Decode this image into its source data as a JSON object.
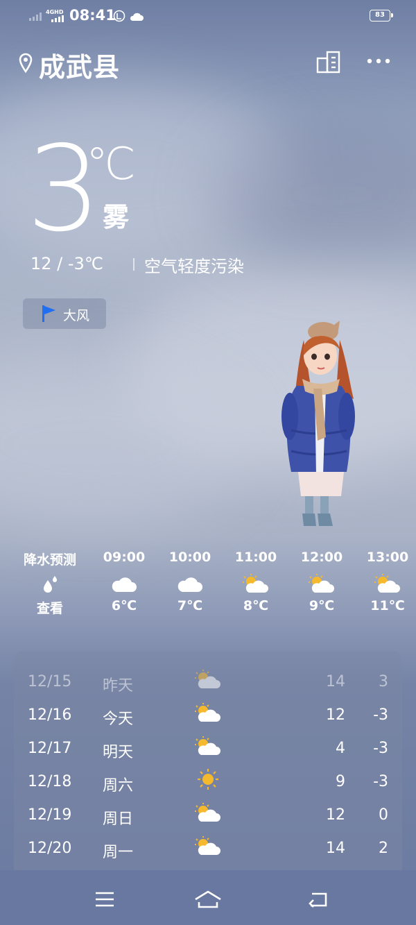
{
  "status_bar": {
    "time": "08:41",
    "network": "4GHD",
    "battery": "83"
  },
  "header": {
    "city": "成武县",
    "location_icon": "location-pin-icon",
    "city_list_icon": "city-list-icon",
    "more_icon": "more-dots-icon"
  },
  "current": {
    "temperature": "3",
    "unit": "℃",
    "condition": "雾",
    "range": "12 / -3℃",
    "air_quality": "空气轻度污染"
  },
  "alert": {
    "label": "大风",
    "icon": "flag-icon",
    "icon_color": "#1f6ff0"
  },
  "hourly": {
    "precip_header": "降水预测",
    "precip_link": "查看",
    "items": [
      {
        "time": "09:00",
        "icon": "cloudy",
        "temp": "6℃"
      },
      {
        "time": "10:00",
        "icon": "cloudy",
        "temp": "7℃"
      },
      {
        "time": "11:00",
        "icon": "partly-cloudy",
        "temp": "8℃"
      },
      {
        "time": "12:00",
        "icon": "partly-cloudy",
        "temp": "9℃"
      },
      {
        "time": "13:00",
        "icon": "partly-cloudy",
        "temp": "11℃"
      }
    ]
  },
  "daily": [
    {
      "date": "12/15",
      "day": "昨天",
      "icon": "partly-cloudy",
      "high": "14",
      "low": "3",
      "past": true
    },
    {
      "date": "12/16",
      "day": "今天",
      "icon": "partly-cloudy",
      "high": "12",
      "low": "-3",
      "past": false
    },
    {
      "date": "12/17",
      "day": "明天",
      "icon": "partly-cloudy",
      "high": "4",
      "low": "-3",
      "past": false
    },
    {
      "date": "12/18",
      "day": "周六",
      "icon": "sunny",
      "high": "9",
      "low": "-3",
      "past": false
    },
    {
      "date": "12/19",
      "day": "周日",
      "icon": "partly-cloudy",
      "high": "12",
      "low": "0",
      "past": false
    },
    {
      "date": "12/20",
      "day": "周一",
      "icon": "partly-cloudy",
      "high": "14",
      "low": "2",
      "past": false
    }
  ],
  "colors": {
    "sun": "#f5b92e",
    "accent": "#1f6ff0"
  }
}
